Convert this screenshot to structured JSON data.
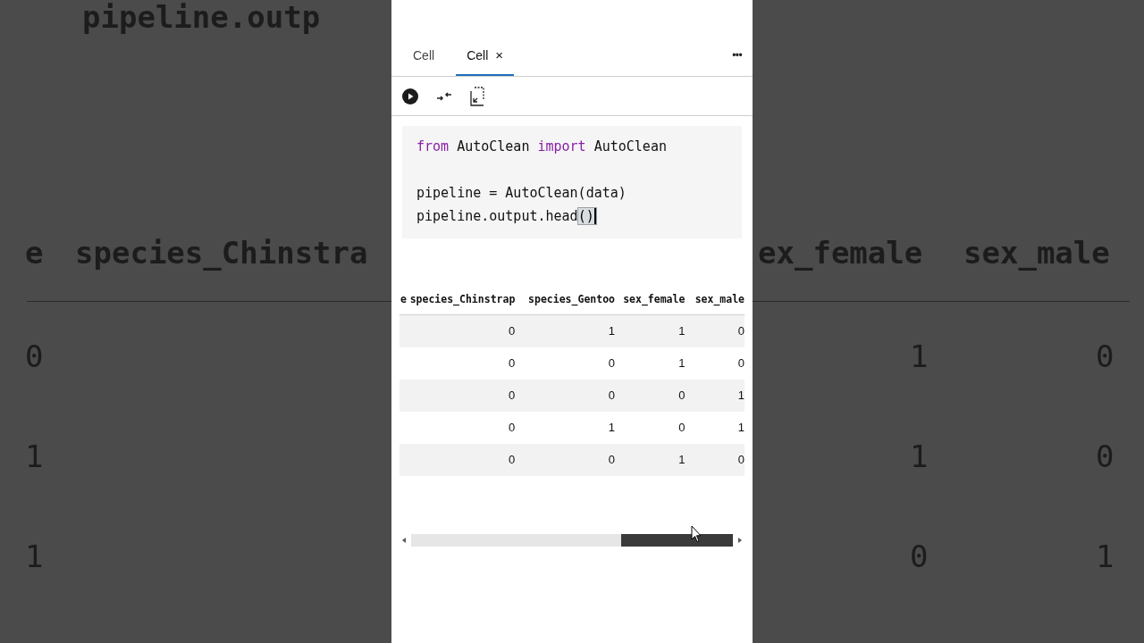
{
  "backdrop": {
    "top_text": "pipeline.outp",
    "left": {
      "headers": [
        "e",
        "species_Chinstra"
      ],
      "rows": [
        "0",
        "1",
        "1"
      ]
    },
    "right": {
      "headers": [
        "ex_female",
        "sex_male"
      ],
      "rows": [
        [
          "1",
          "0"
        ],
        [
          "1",
          "0"
        ],
        [
          "0",
          "1"
        ]
      ]
    }
  },
  "tabs": [
    {
      "label": "Cell",
      "selected": false
    },
    {
      "label": "Cell",
      "selected": true,
      "close": "×"
    }
  ],
  "more": "•••",
  "code": [
    {
      "kind": "text",
      "tokens": [
        {
          "kind": "keyword",
          "text": "from"
        },
        {
          "kind": "plain",
          "text": " AutoClean "
        },
        {
          "kind": "keyword",
          "text": "import"
        },
        {
          "kind": "plain",
          "text": " AutoClean"
        }
      ]
    },
    {
      "kind": "blank"
    },
    {
      "kind": "text",
      "tokens": [
        {
          "kind": "plain",
          "text": "pipeline = AutoClean(data)"
        }
      ]
    },
    {
      "kind": "text",
      "tokens": [
        {
          "kind": "plain",
          "text": "pipeline.output.head"
        },
        {
          "kind": "match",
          "text": "()"
        }
      ]
    }
  ],
  "table": {
    "columns": [
      "e",
      "species_Chinstrap",
      "species_Gentoo",
      "sex_female",
      "sex_male"
    ],
    "rows": [
      [
        "",
        "0",
        "1",
        "1",
        "0"
      ],
      [
        "",
        "0",
        "0",
        "1",
        "0"
      ],
      [
        "",
        "0",
        "0",
        "0",
        "1"
      ],
      [
        "",
        "0",
        "1",
        "0",
        "1"
      ],
      [
        "",
        "0",
        "0",
        "1",
        "0"
      ]
    ]
  }
}
